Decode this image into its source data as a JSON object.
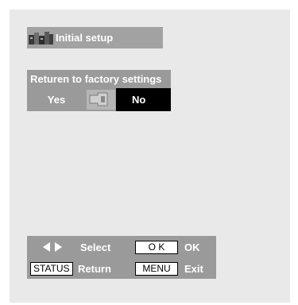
{
  "title_bar": {
    "title": "Initial setup",
    "icon": "setup-menu-icon"
  },
  "menu": {
    "header": "Returen to factory settings",
    "options": {
      "yes": "Yes",
      "no": "No",
      "icon": "remote-hand-icon",
      "selected": "No"
    }
  },
  "help": {
    "select_label": "Select",
    "ok_key": "O K",
    "ok_label": "OK",
    "status_key": "STATUS",
    "return_label": "Return",
    "menu_key": "MENU",
    "exit_label": "Exit"
  },
  "colors": {
    "bar": "#9a9a9a",
    "title_bar": "#a2a2a2",
    "selected": "#000000",
    "background": "#e9e9e9"
  }
}
